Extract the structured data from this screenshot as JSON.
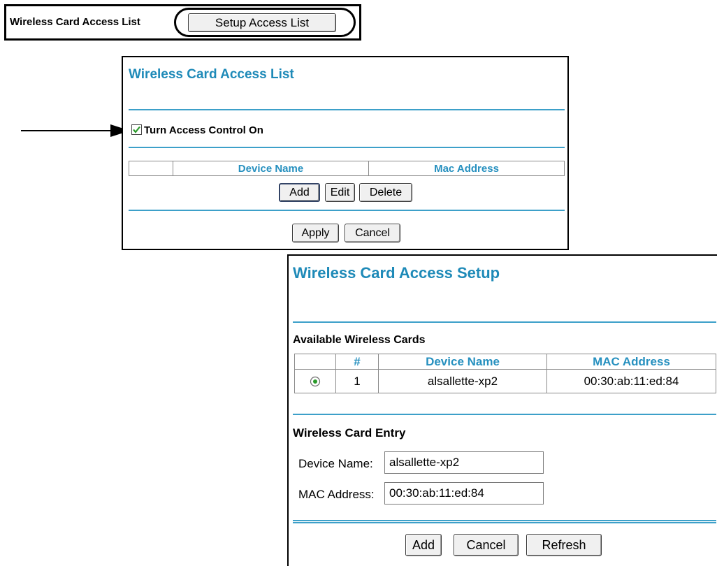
{
  "top_bar": {
    "label": "Wireless Card Access List",
    "button_label": "Setup Access List"
  },
  "access_list": {
    "title": "Wireless Card Access List",
    "access_control_label": "Turn Access Control On",
    "access_control_checked": true,
    "columns": [
      "",
      "Device Name",
      "Mac Address"
    ],
    "buttons": {
      "add": "Add",
      "edit": "Edit",
      "delete": "Delete"
    },
    "apply_label": "Apply",
    "cancel_label": "Cancel"
  },
  "access_setup": {
    "title": "Wireless Card Access Setup",
    "available_heading": "Available Wireless Cards",
    "columns": [
      "",
      "#",
      "Device Name",
      "MAC Address"
    ],
    "rows": [
      {
        "selected": true,
        "num": "1",
        "device_name": "alsallette-xp2",
        "mac": "00:30:ab:11:ed:84"
      }
    ],
    "entry_heading": "Wireless Card Entry",
    "device_name_label": "Device Name:",
    "device_name_value": "alsallette-xp2",
    "mac_label": "MAC Address:",
    "mac_value": "00:30:ab:11:ed:84",
    "buttons": {
      "add": "Add",
      "cancel": "Cancel",
      "refresh": "Refresh"
    }
  },
  "colors": {
    "accent": "#1e8ab8",
    "rule": "#3da0c9",
    "check": "#2a9a2a"
  },
  "icons": [
    "pointer-arrow-icon",
    "checkmark-icon",
    "radio-selected-icon"
  ]
}
